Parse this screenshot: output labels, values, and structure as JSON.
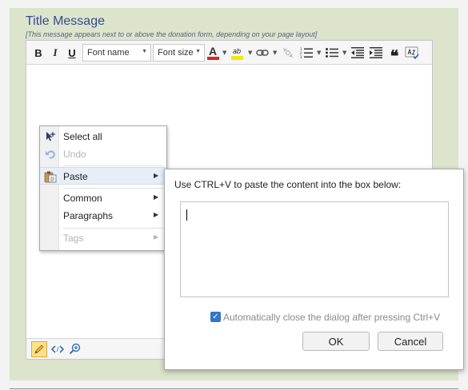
{
  "section": {
    "title": "Title Message",
    "hint": "[This message appears next to or above the donation form, depending on your page layout]"
  },
  "toolbar": {
    "bold_label": "B",
    "italic_label": "I",
    "underline_label": "U",
    "font_name_label": "Font name",
    "font_size_label": "Font size",
    "font_color_glyph": "A",
    "highlight_glyph": "ab",
    "blockquote_glyph": "❝",
    "colors": {
      "font_color": "#d42a1e",
      "highlight": "#f2e80a"
    }
  },
  "context_menu": {
    "items": [
      {
        "label": "Select all",
        "icon": "select-all-icon",
        "enabled": true
      },
      {
        "label": "Undo",
        "icon": "undo-icon",
        "enabled": false
      },
      {
        "label": "Paste",
        "icon": "paste-icon",
        "enabled": true,
        "submenu": true,
        "highlighted": true
      },
      {
        "label": "Common",
        "enabled": true,
        "submenu": true
      },
      {
        "label": "Paragraphs",
        "enabled": true,
        "submenu": true
      },
      {
        "label": "Tags",
        "enabled": false,
        "submenu": true
      }
    ]
  },
  "paste_dialog": {
    "message": "Use CTRL+V to paste the content into the box below:",
    "checkbox_label": "Automatically close the dialog after pressing Ctrl+V",
    "checkbox_checked": true,
    "ok_label": "OK",
    "cancel_label": "Cancel"
  },
  "bottombar": {
    "icons": [
      "pencil-icon",
      "code-view-icon",
      "zoom-in-icon"
    ]
  }
}
